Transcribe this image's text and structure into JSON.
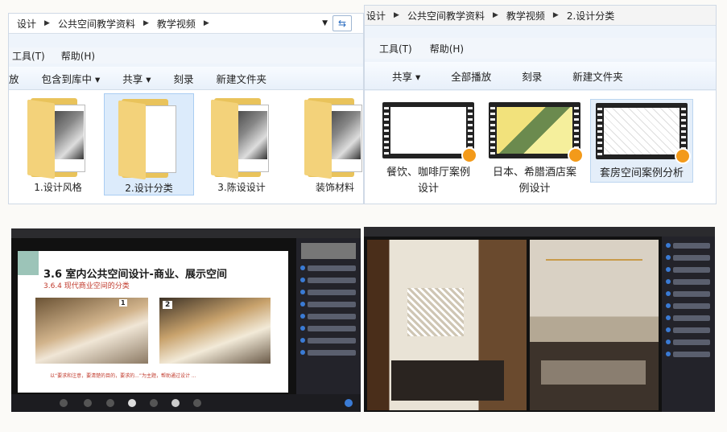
{
  "left_window": {
    "breadcrumb": [
      "设计",
      "公共空间教学资料",
      "教学视频"
    ],
    "menu": [
      "工具(T)",
      "帮助(H)"
    ],
    "toolbar": [
      "放",
      "包含到库中 ▾",
      "共享 ▾",
      "刻录",
      "新建文件夹"
    ],
    "folders": [
      {
        "label": "1.设计风格",
        "selected": false
      },
      {
        "label": "2.设计分类",
        "selected": true
      },
      {
        "label": "3.陈设设计",
        "selected": false
      },
      {
        "label": "装饰材料",
        "selected": false
      }
    ]
  },
  "right_window": {
    "breadcrumb": [
      "设计",
      "公共空间教学资料",
      "教学视频",
      "2.设计分类"
    ],
    "menu": [
      "工具(T)",
      "帮助(H)"
    ],
    "toolbar": [
      "共享 ▾",
      "全部播放",
      "刻录",
      "新建文件夹"
    ],
    "videos": [
      {
        "label": "餐饮、咖啡厅案例设计",
        "selected": false
      },
      {
        "label": "日本、希腊酒店案例设计",
        "selected": false
      },
      {
        "label": "套房空间案例分析",
        "selected": true
      }
    ]
  },
  "lesson_slide": {
    "title": "3.6 室内公共空间设计-商业、展示空间",
    "subtitle": "3.6.4 现代商业空间的分类",
    "markers": [
      "1",
      "2"
    ],
    "caption": "以“要求和注意，要清楚的目的，要求的...”为主题，帮助通过设计 ..."
  },
  "colors": {
    "folder": "#e9c35b",
    "accent": "#3a7bd5",
    "play": "#f39a1a",
    "dark_ui": "#23232a"
  }
}
